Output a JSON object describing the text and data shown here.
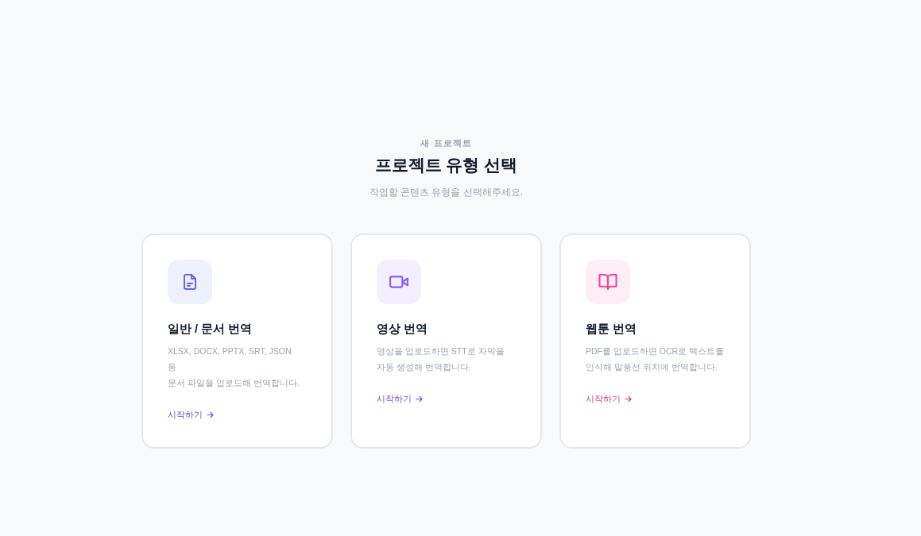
{
  "header": {
    "eyebrow": "새 프로젝트",
    "title": "프로젝트 유형 선택",
    "subtitle": "작업할 콘텐츠 유형을 선택해주세요."
  },
  "project_types": [
    {
      "kind": "document",
      "color": "#6366f1",
      "title": "일반 / 문서 번역",
      "description": "XLSX, DOCX, PPTX, SRT, JSON\n등\n문서 파일을 업로드해 번역합니다.",
      "action": "시작하기"
    },
    {
      "kind": "video",
      "color": "#8b5cf6",
      "title": "영상 번역",
      "description": "영상을 업로드하면 STT로 자막을\n자동 생성해 번역합니다.",
      "action": "시작하기"
    },
    {
      "kind": "webtoon",
      "color": "#ec4899",
      "title": "웹툰 번역",
      "description": "PDF를 업로드하면 OCR로 텍스트를\n인식해 말풍선 위치에 번역합니다.",
      "action": "시작하기"
    }
  ]
}
